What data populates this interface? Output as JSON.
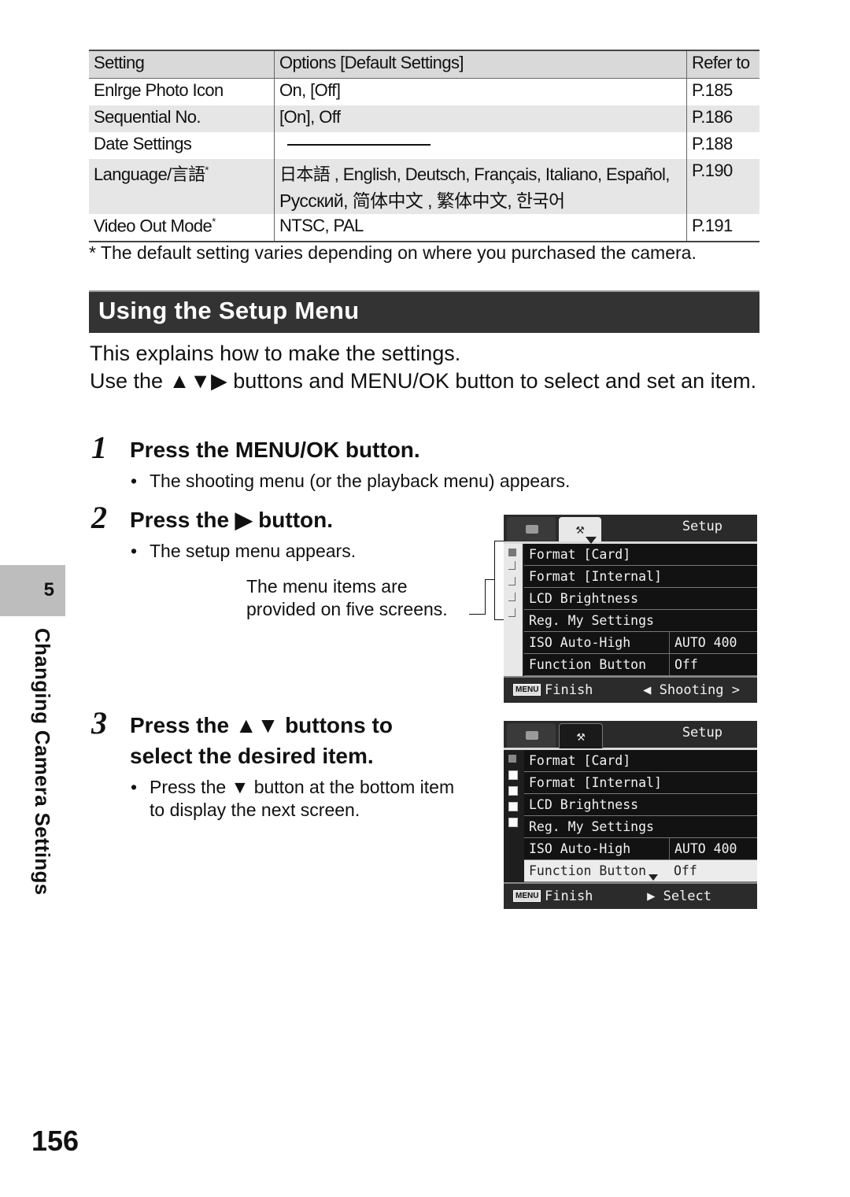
{
  "table": {
    "headers": [
      "Setting",
      "Options [Default Settings]",
      "Refer to"
    ],
    "rows": [
      {
        "setting": "Enlrge Photo Icon",
        "options": "On, [Off]",
        "refer": "P.185",
        "shaded": false
      },
      {
        "setting": "Sequential No.",
        "options": "[On], Off",
        "refer": "P.186",
        "shaded": true
      },
      {
        "setting": "Date Settings",
        "options": "",
        "refer": "P.188",
        "shaded": false
      },
      {
        "setting": "Language/言語",
        "setting_mark": "*",
        "options": "日本語 , English, Deutsch, Français, Italiano, Español,",
        "options_line2": "Русский, 简体中文 , 繁体中文, 한국어",
        "refer": "P.190",
        "shaded": true
      },
      {
        "setting": "Video Out Mode",
        "setting_mark": "*",
        "options": "NTSC, PAL",
        "refer": "P.191",
        "shaded": false
      }
    ]
  },
  "footnote": "*  The default setting varies depending on where you purchased the camera.",
  "section": {
    "title": "Using the Setup Menu"
  },
  "intro": {
    "line1": "This explains how to make the settings.",
    "line2_prefix": "Use the ",
    "line2_arrows": "▲▼▶",
    "line2_suffix": " buttons and MENU/OK button to select and set an item."
  },
  "steps": [
    {
      "number": "1",
      "title": "Press the MENU/OK button.",
      "bullets": [
        "The shooting menu (or the playback menu) appears."
      ]
    },
    {
      "number": "2",
      "title_prefix": "Press the ",
      "title_arrow": "▶",
      "title_suffix": " button.",
      "bullets": [
        "The setup menu appears."
      ],
      "note": [
        "The menu items are",
        "provided on five screens."
      ]
    },
    {
      "number": "3",
      "title_prefix": "Press the ",
      "title_arrow": "▲▼",
      "title_suffix": " buttons to",
      "title_line2": "select the desired item.",
      "bullet_prefix": "Press the ",
      "bullet_arrow": "▼",
      "bullet_suffix": " button at the bottom item",
      "bullet_line2": "to display the next screen."
    }
  ],
  "camera_screens": [
    {
      "tab_label": "Setup",
      "items": [
        {
          "label": "Format [Card]",
          "value": ""
        },
        {
          "label": "Format [Internal]",
          "value": ""
        },
        {
          "label": "LCD Brightness",
          "value": ""
        },
        {
          "label": "Reg. My Settings",
          "value": ""
        },
        {
          "label": "ISO Auto-High",
          "value": "AUTO 400"
        },
        {
          "label": "Function Button",
          "value": "Off"
        }
      ],
      "footer_badge": "MENU",
      "footer_left": "Finish",
      "footer_right": "◀ Shooting >"
    },
    {
      "tab_label": "Setup",
      "items": [
        {
          "label": "Format [Card]",
          "value": ""
        },
        {
          "label": "Format [Internal]",
          "value": ""
        },
        {
          "label": "LCD Brightness",
          "value": ""
        },
        {
          "label": "Reg. My Settings",
          "value": ""
        },
        {
          "label": "ISO Auto-High",
          "value": "AUTO 400"
        },
        {
          "label": "Function Button",
          "value": "Off",
          "selected": true
        }
      ],
      "footer_badge": "MENU",
      "footer_left": "Finish",
      "footer_right": "▶ Select"
    }
  ],
  "sidebar": {
    "chapter_number": "5",
    "chapter_title": "Changing Camera Settings"
  },
  "page_number": "156"
}
